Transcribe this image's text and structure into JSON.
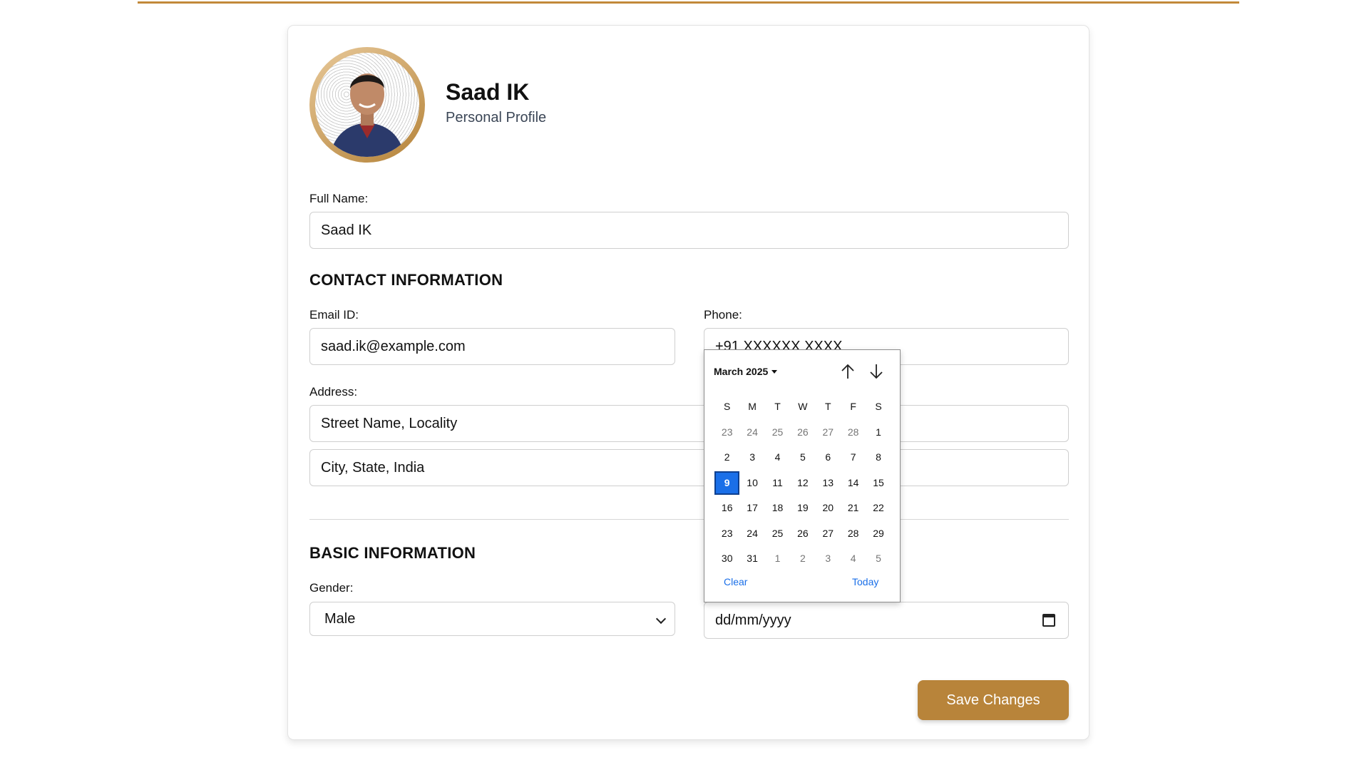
{
  "profile": {
    "name": "Saad IK",
    "subtitle": "Personal Profile"
  },
  "full_name": {
    "label": "Full Name:",
    "value": "Saad IK"
  },
  "contact": {
    "title": "CONTACT INFORMATION",
    "email_label": "Email ID:",
    "email_value": "saad.ik@example.com",
    "phone_label": "Phone:",
    "phone_value": "+91 XXXXXX XXXX",
    "address_label": "Address:",
    "address_line1": "Street Name, Locality",
    "address_line2": "City, State, India"
  },
  "basic": {
    "title": "BASIC INFORMATION",
    "gender_label": "Gender:",
    "gender_value": "Male",
    "dob_placeholder": "dd/mm/yyyy"
  },
  "save_label": "Save Changes",
  "calendar": {
    "month_label": "March 2025",
    "weekdays": [
      "S",
      "M",
      "T",
      "W",
      "T",
      "F",
      "S"
    ],
    "weeks": [
      [
        "23",
        "24",
        "25",
        "26",
        "27",
        "28",
        "1"
      ],
      [
        "2",
        "3",
        "4",
        "5",
        "6",
        "7",
        "8"
      ],
      [
        "9",
        "10",
        "11",
        "12",
        "13",
        "14",
        "15"
      ],
      [
        "16",
        "17",
        "18",
        "19",
        "20",
        "21",
        "22"
      ],
      [
        "23",
        "24",
        "25",
        "26",
        "27",
        "28",
        "29"
      ],
      [
        "30",
        "31",
        "1",
        "2",
        "3",
        "4",
        "5"
      ]
    ],
    "selected_day": "9",
    "clear_label": "Clear",
    "today_label": "Today",
    "prev_icon": "arrow-up-icon",
    "next_icon": "arrow-down-icon"
  },
  "colors": {
    "accent": "#b8843a",
    "top_rule": "#c2893a",
    "selected_day": "#1a6fe8"
  }
}
